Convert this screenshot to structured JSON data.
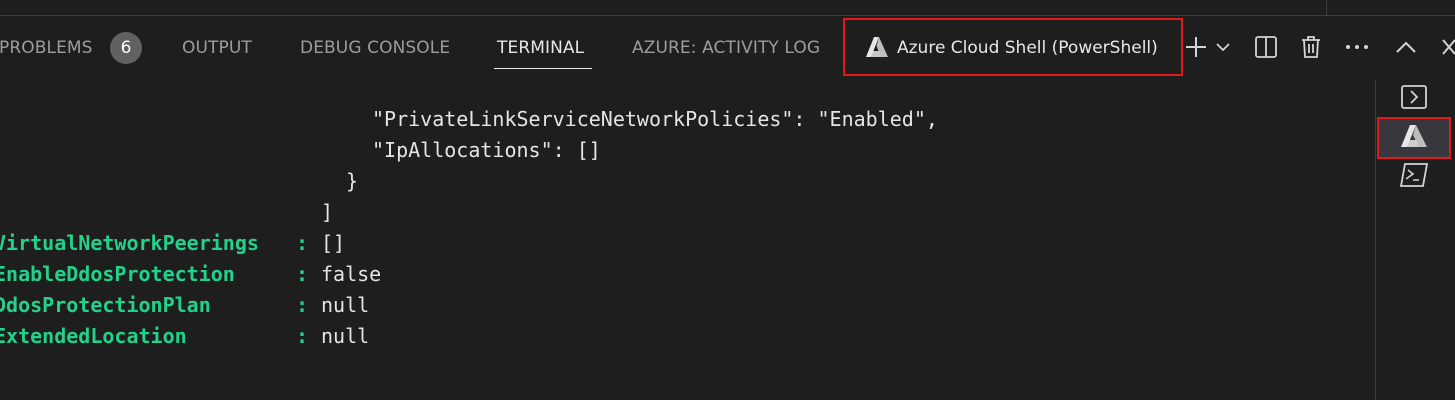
{
  "panel": {
    "tabs": [
      {
        "label": "PROBLEMS",
        "badge": "6"
      },
      {
        "label": "OUTPUT"
      },
      {
        "label": "DEBUG CONSOLE"
      },
      {
        "label": "TERMINAL"
      },
      {
        "label": "AZURE: ACTIVITY LOG"
      }
    ],
    "active_tab": "TERMINAL",
    "terminal_instance": {
      "label": "Azure Cloud Shell (PowerShell)",
      "icon": "azure-icon"
    },
    "actions": [
      "add-icon",
      "chevron-down-icon",
      "split-icon",
      "trash-icon",
      "more-icon",
      "chevron-up-icon",
      "close-icon"
    ]
  },
  "terminal": {
    "json_lines": [
      "\"PrivateLinkServiceNetworkPolicies\": \"Enabled\",",
      "\"IpAllocations\": []",
      "}",
      "]"
    ],
    "properties": [
      {
        "key": "VirtualNetworkPeerings",
        "sep": ":",
        "value": "[]"
      },
      {
        "key": "EnableDdosProtection",
        "sep": ":",
        "value": "false"
      },
      {
        "key": "DdosProtectionPlan",
        "sep": ":",
        "value": "null"
      },
      {
        "key": "ExtendedLocation",
        "sep": ":",
        "value": "null"
      }
    ]
  },
  "side_list": {
    "items": [
      {
        "icon": "chevron-right-box-icon"
      },
      {
        "icon": "azure-icon",
        "selected": true
      },
      {
        "icon": "powershell-icon"
      }
    ]
  },
  "colors": {
    "background": "#1e1e1e",
    "property_key": "#23d18b",
    "highlight_border": "#e01a1a"
  }
}
